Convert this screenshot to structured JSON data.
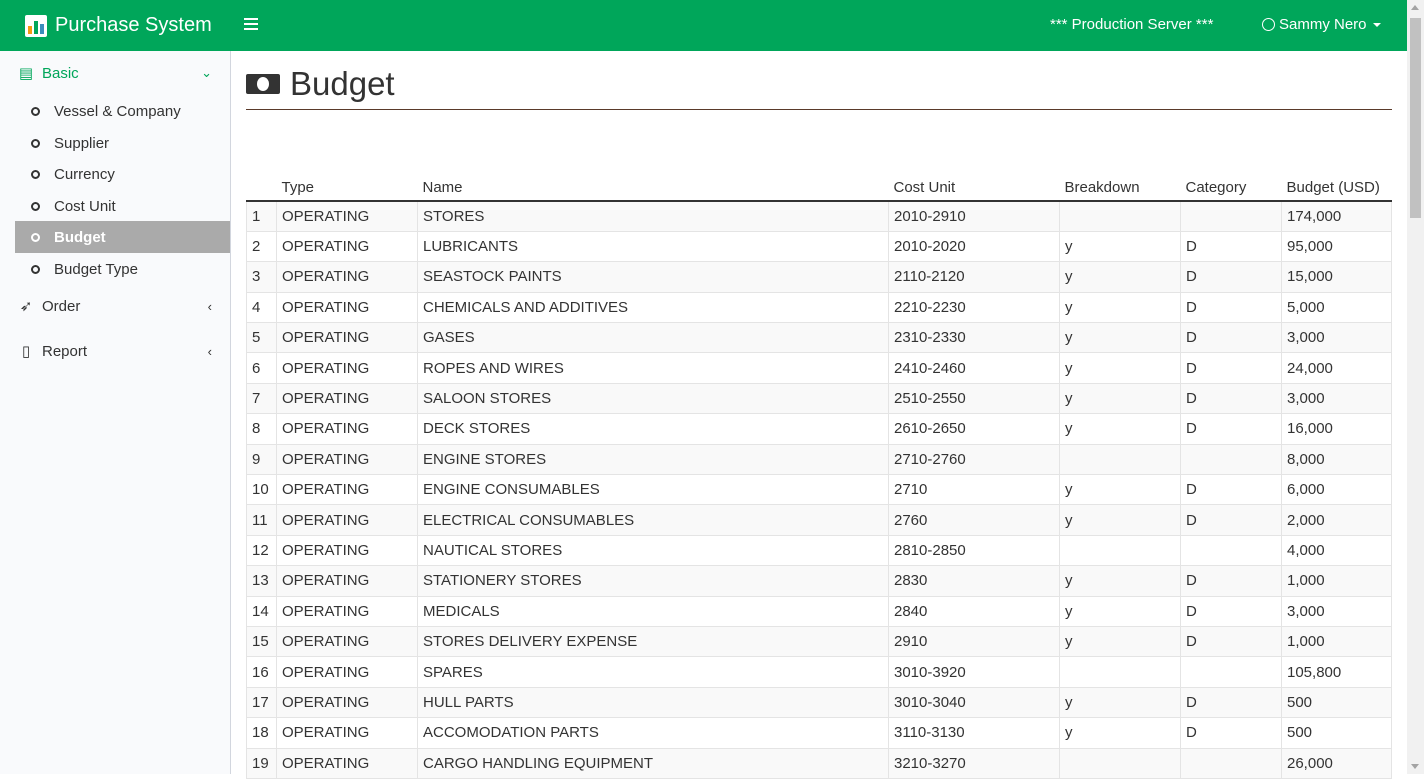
{
  "app": {
    "title": "Purchase System",
    "server": "*** Production Server ***",
    "user": "Sammy Nero"
  },
  "sidebar": {
    "basic": "Basic",
    "items": [
      "Vessel & Company",
      "Supplier",
      "Currency",
      "Cost Unit",
      "Budget",
      "Budget Type"
    ],
    "active_index": 4,
    "order": "Order",
    "report": "Report"
  },
  "page": {
    "title": "Budget"
  },
  "table": {
    "headers": [
      "",
      "Type",
      "Name",
      "Cost Unit",
      "Breakdown",
      "Category",
      "Budget (USD)"
    ],
    "rows": [
      [
        "1",
        "OPERATING",
        "STORES",
        "2010-2910",
        "",
        "",
        "174,000"
      ],
      [
        "2",
        "OPERATING",
        "LUBRICANTS",
        "2010-2020",
        "y",
        "D",
        "95,000"
      ],
      [
        "3",
        "OPERATING",
        "SEASTOCK PAINTS",
        "2110-2120",
        "y",
        "D",
        "15,000"
      ],
      [
        "4",
        "OPERATING",
        "CHEMICALS AND ADDITIVES",
        "2210-2230",
        "y",
        "D",
        "5,000"
      ],
      [
        "5",
        "OPERATING",
        "GASES",
        "2310-2330",
        "y",
        "D",
        "3,000"
      ],
      [
        "6",
        "OPERATING",
        "ROPES AND WIRES",
        "2410-2460",
        "y",
        "D",
        "24,000"
      ],
      [
        "7",
        "OPERATING",
        "SALOON STORES",
        "2510-2550",
        "y",
        "D",
        "3,000"
      ],
      [
        "8",
        "OPERATING",
        "DECK STORES",
        "2610-2650",
        "y",
        "D",
        "16,000"
      ],
      [
        "9",
        "OPERATING",
        "ENGINE STORES",
        "2710-2760",
        "",
        "",
        "8,000"
      ],
      [
        "10",
        "OPERATING",
        "ENGINE CONSUMABLES",
        "2710",
        "y",
        "D",
        "6,000"
      ],
      [
        "11",
        "OPERATING",
        "ELECTRICAL CONSUMABLES",
        "2760",
        "y",
        "D",
        "2,000"
      ],
      [
        "12",
        "OPERATING",
        "NAUTICAL STORES",
        "2810-2850",
        "",
        "",
        "4,000"
      ],
      [
        "13",
        "OPERATING",
        "STATIONERY STORES",
        "2830",
        "y",
        "D",
        "1,000"
      ],
      [
        "14",
        "OPERATING",
        "MEDICALS",
        "2840",
        "y",
        "D",
        "3,000"
      ],
      [
        "15",
        "OPERATING",
        "STORES DELIVERY EXPENSE",
        "2910",
        "y",
        "D",
        "1,000"
      ],
      [
        "16",
        "OPERATING",
        "SPARES",
        "3010-3920",
        "",
        "",
        "105,800"
      ],
      [
        "17",
        "OPERATING",
        "HULL PARTS",
        "3010-3040",
        "y",
        "D",
        "500"
      ],
      [
        "18",
        "OPERATING",
        "ACCOMODATION PARTS",
        "3110-3130",
        "y",
        "D",
        "500"
      ],
      [
        "19",
        "OPERATING",
        "CARGO HANDLING EQUIPMENT",
        "3210-3270",
        "",
        "",
        "26,000"
      ]
    ]
  },
  "colors": {
    "brand": "#00a65a",
    "active_bg": "#aaaaaa"
  },
  "icons": [
    "bar-chart-icon",
    "hamburger-icon",
    "smile-icon",
    "newspaper-icon",
    "rocket-icon",
    "file-icon",
    "money-icon"
  ]
}
